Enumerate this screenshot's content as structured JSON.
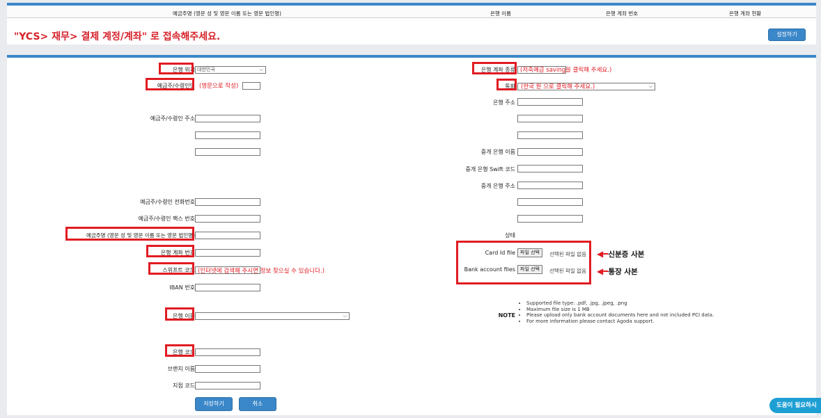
{
  "top": {
    "headers": [
      "예금주명 (영문 성 및 영문 이름 또는 영문 법인명)",
      "은행 이름",
      "은행 계좌 번호",
      "은행 계좌 현황"
    ],
    "notice": "\"YCS> 재무> 결제 계정/계좌\" 로 접속해주세요.",
    "settings_button": "설정하기"
  },
  "left": {
    "bank_location_label": "은행 위치",
    "bank_location_value": "대한민국",
    "holder_name_label": "예금주/수령인명",
    "holder_name_hint": "(영문으로 작성)",
    "holder_address_label": "예금주/수령인 주소",
    "holder_phone_label": "예금주/수령인 전화번호",
    "holder_fax_label": "예금주/수령인 팩스 번호",
    "holder_fullname_label": "예금주명 (영문 성 및 영문 이름 또는 영문 법인명)",
    "account_number_label": "은행 계좌 번호",
    "swift_label": "스위프트 코드",
    "swift_hint": "(인터넷에 검색해 주시면 정보 찾으실 수 있습니다.)",
    "iban_label": "IBAN 번호",
    "bank_name_label": "은행 이름",
    "bank_code_label": "은행 코드",
    "branch_name_label": "브랜치 이름",
    "branch_code_label": "지점 코드",
    "save_button": "저장하기",
    "cancel_button": "취소"
  },
  "right": {
    "account_type_label": "은행 계좌 종류",
    "account_type_hint": "(저축예금 saving을 클릭해 주세요.)",
    "currency_label": "통화",
    "currency_hint": "(한국 원 으로 클릭해 주세요.)",
    "bank_address_label": "은행 주소",
    "intermediary_name_label": "중개 은행 이름",
    "intermediary_swift_label": "중개 은행 Swift 코드",
    "intermediary_address_label": "중개 은행 주소",
    "status_label": "상태",
    "card_id_label": "Card Id file",
    "bank_files_label": "Bank account files",
    "file_button": "파일 선택",
    "no_file_text": "선택된 파일 없음",
    "card_annotation": "신분증 사본",
    "bank_annotation": "통장 사본",
    "note_label": "NOTE",
    "notes": [
      "Supported file type: .pdf, .jpg, .jpeg, .png",
      "Maximum file size is 1 MB",
      "Please upload only bank account documents here and not included PCI data.",
      "For more information please contact Agoda support."
    ]
  },
  "help_button": "도움이 필요하시",
  "colors": {
    "accent": "#3a87c9",
    "highlight": "#e11b22"
  }
}
